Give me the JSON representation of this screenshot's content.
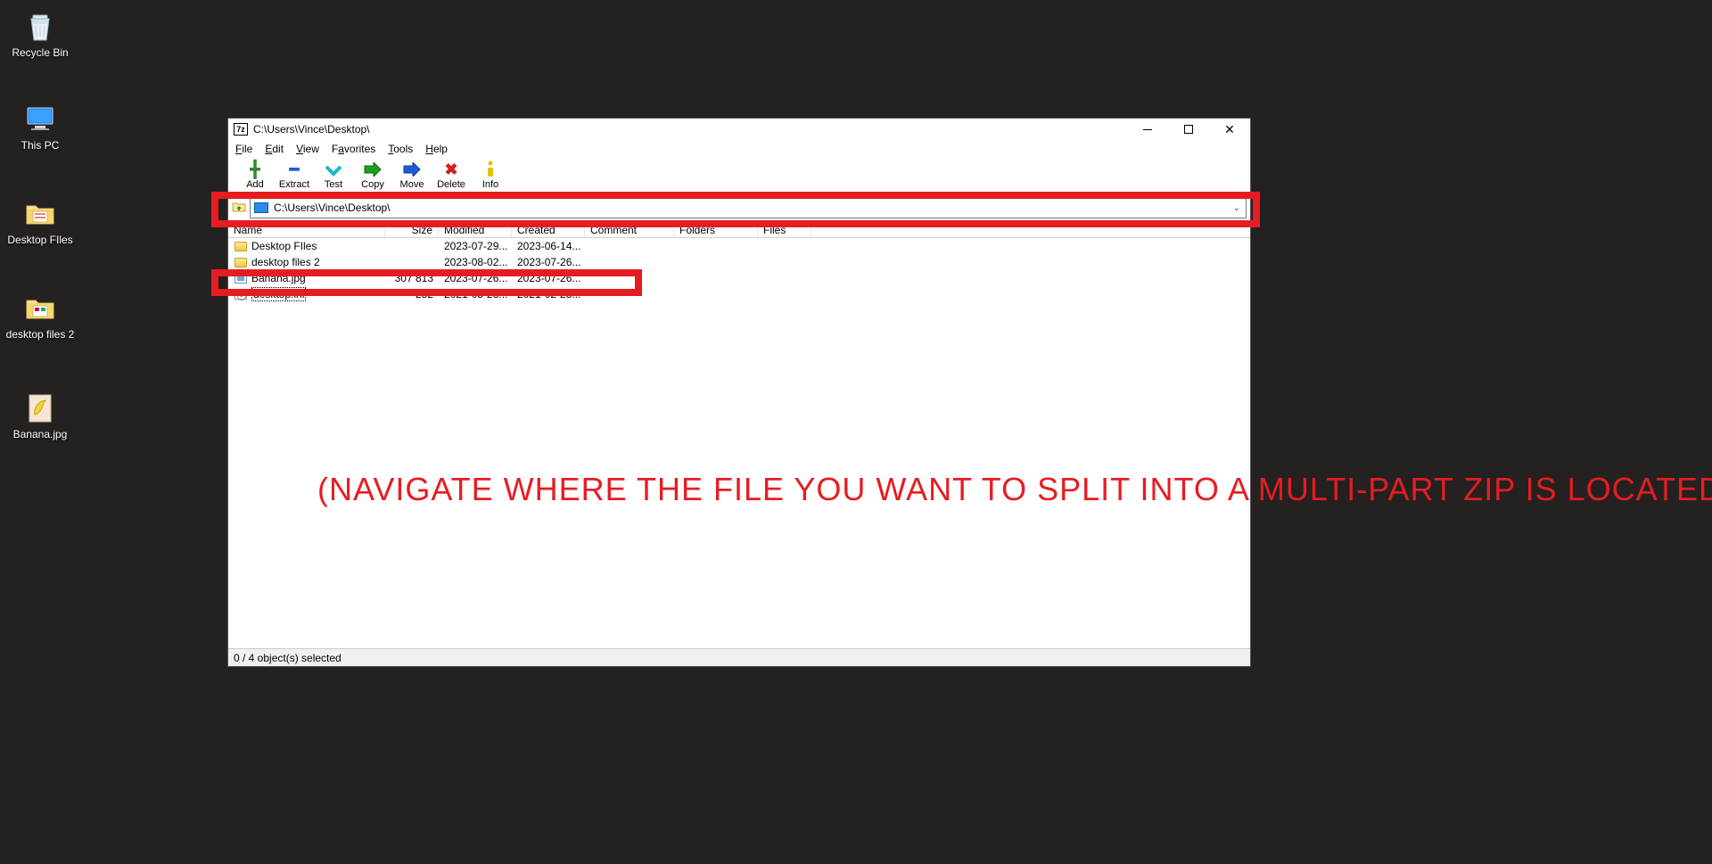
{
  "desktop": {
    "icons": [
      {
        "name": "recycle-bin",
        "label": "Recycle Bin"
      },
      {
        "name": "this-pc",
        "label": "This PC"
      },
      {
        "name": "desktop-files",
        "label": "Desktop FIles"
      },
      {
        "name": "desktop-files-2",
        "label": "desktop files 2"
      },
      {
        "name": "banana",
        "label": "Banana.jpg"
      }
    ]
  },
  "window": {
    "title": "C:\\Users\\Vince\\Desktop\\",
    "menu": [
      "File",
      "Edit",
      "View",
      "Favorites",
      "Tools",
      "Help"
    ],
    "toolbar": [
      {
        "name": "add",
        "label": "Add",
        "glyph": "✚",
        "color": "#2e8b2e"
      },
      {
        "name": "extract",
        "label": "Extract",
        "glyph": "▬",
        "color": "#1e5bd6"
      },
      {
        "name": "test",
        "label": "Test",
        "glyph": "✔",
        "color": "#17a2b8",
        "shape": "test"
      },
      {
        "name": "copy",
        "label": "Copy",
        "glyph": "➡",
        "color": "#1aa31a",
        "shape": "copy"
      },
      {
        "name": "move",
        "label": "Move",
        "glyph": "➡",
        "color": "#1e5bd6"
      },
      {
        "name": "delete",
        "label": "Delete",
        "glyph": "✖",
        "color": "#d32020"
      },
      {
        "name": "info",
        "label": "Info",
        "glyph": "ℹ",
        "color": "#c8a400",
        "shape": "info"
      }
    ],
    "path": "C:\\Users\\Vince\\Desktop\\",
    "columns": [
      "Name",
      "Size",
      "Modified",
      "Created",
      "Comment",
      "Folders",
      "Files"
    ],
    "rows": [
      {
        "type": "folder",
        "name": "Desktop FIles",
        "size": "",
        "mod": "2023-07-29...",
        "cre": "2023-06-14..."
      },
      {
        "type": "folder",
        "name": "desktop files 2",
        "size": "",
        "mod": "2023-08-02...",
        "cre": "2023-07-26..."
      },
      {
        "type": "image",
        "name": "Banana.jpg",
        "size": "307 813",
        "mod": "2023-07-26...",
        "cre": "2023-07-26..."
      },
      {
        "type": "ini",
        "name": "desktop.ini",
        "size": "282",
        "mod": "2021-05-23...",
        "cre": "2021-02-28...",
        "selected": true
      }
    ],
    "status": "0 / 4 object(s) selected"
  },
  "annotation": "(NAVIGATE WHERE THE FILE YOU WANT TO SPLIT INTO A MULTI-PART ZIP IS LOCATED)"
}
